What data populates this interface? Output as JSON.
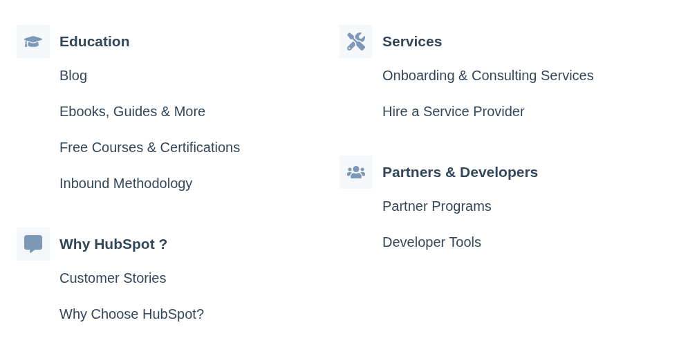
{
  "columns": [
    {
      "groups": [
        {
          "title": "Education",
          "links": [
            "Blog",
            "Ebooks, Guides & More",
            "Free Courses & Certifications",
            "Inbound Methodology"
          ]
        },
        {
          "title": "Why HubSpot ?",
          "links": [
            "Customer Stories",
            "Why Choose HubSpot?"
          ]
        }
      ]
    },
    {
      "groups": [
        {
          "title": "Services",
          "links": [
            "Onboarding & Consulting Services",
            "Hire a Service Provider"
          ]
        },
        {
          "title": "Partners & Developers",
          "links": [
            "Partner Programs",
            "Developer Tools"
          ]
        }
      ]
    }
  ]
}
